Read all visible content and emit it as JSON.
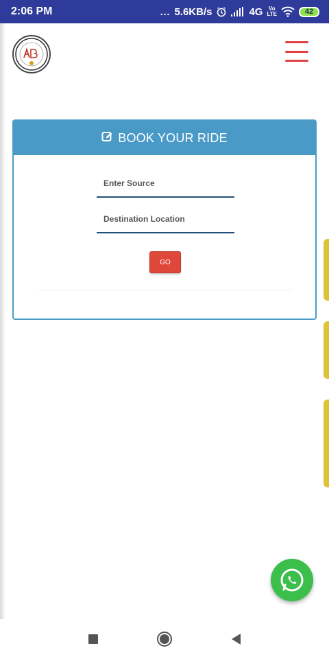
{
  "status_bar": {
    "time": "2:06 PM",
    "dots": "...",
    "speed": "5.6KB/s",
    "network": "4G",
    "volte_top": "Vo",
    "volte_bottom": "LTE",
    "battery": "42",
    "icons": [
      "alarm-icon",
      "signal-icon",
      "wifi-icon",
      "battery-icon"
    ]
  },
  "header": {
    "logo": "company-logo",
    "menu_icon": "hamburger-icon"
  },
  "booking": {
    "title": "BOOK YOUR RIDE",
    "title_icon": "edit-icon",
    "source_placeholder": "Enter Source",
    "destination_placeholder": "Destination Location",
    "go_label": "GO"
  },
  "floating": {
    "icon": "whatsapp-icon"
  },
  "nav": {
    "icons": [
      "recent-apps-icon",
      "home-icon",
      "back-icon"
    ]
  },
  "colors": {
    "status_bar": "#2f3b9a",
    "header_blue": "#4a9ac8",
    "go_red": "#e0473b",
    "menu_red": "#e04040",
    "whatsapp_green": "#3cbf4a",
    "input_underline": "#1f4f78"
  }
}
